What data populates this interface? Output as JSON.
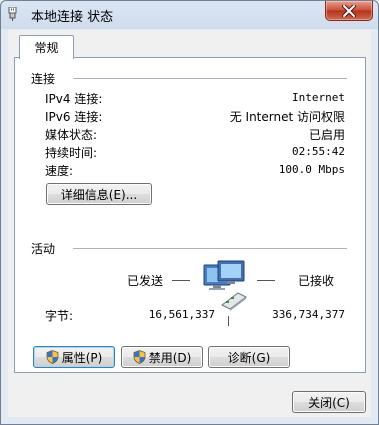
{
  "window": {
    "title": "本地连接 状态",
    "close_label": "关闭(C)"
  },
  "tabs": [
    {
      "label": "常规",
      "selected": true
    }
  ],
  "connection": {
    "section_title": "连接",
    "rows": [
      {
        "label": "IPv4 连接:",
        "value": "Internet"
      },
      {
        "label": "IPv6 连接:",
        "value": "无 Internet 访问权限"
      },
      {
        "label": "媒体状态:",
        "value": "已启用"
      },
      {
        "label": "持续时间:",
        "value": "02:55:42"
      },
      {
        "label": "速度:",
        "value": "100.0 Mbps"
      }
    ],
    "details_button": "详细信息(E)..."
  },
  "activity": {
    "section_title": "活动",
    "sent_label": "已发送",
    "received_label": "已接收",
    "bytes_label": "字节:",
    "bytes_sent": "16,561,337",
    "bytes_received": "336,734,377"
  },
  "action_buttons": {
    "properties": "属性(P)",
    "disable": "禁用(D)",
    "diagnose": "诊断(G)"
  },
  "colors": {
    "title_gradient_top": "#dbe6f4",
    "close_button_red": "#c94d36",
    "panel_bg": "#ffffff",
    "group_line": "#a9b3c1"
  },
  "icons": [
    "network-adapter-icon",
    "close-icon",
    "shield-icon",
    "network-computers-icon"
  ]
}
